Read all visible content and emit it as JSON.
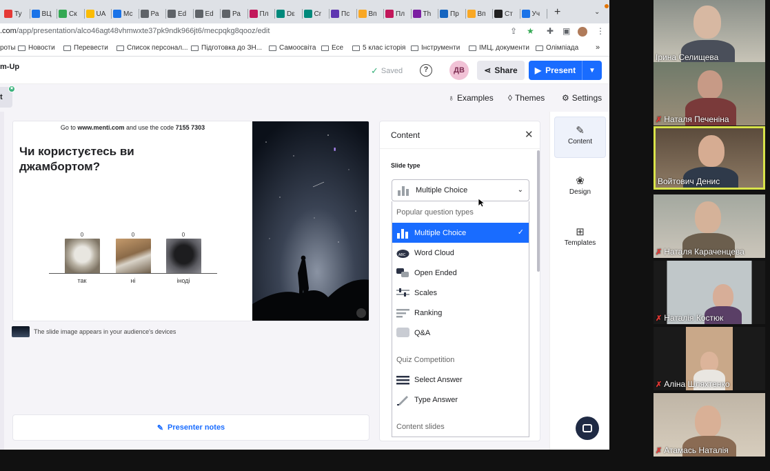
{
  "browser": {
    "tabs": [
      {
        "label": "Ty",
        "color": "#e53935"
      },
      {
        "label": "ВЦ",
        "color": "#1a73e8"
      },
      {
        "label": "Ск",
        "color": "#34a853"
      },
      {
        "label": "UA",
        "color": "#fbbc04"
      },
      {
        "label": "Мс",
        "color": "#1a73e8"
      },
      {
        "label": "Ра",
        "color": "#5f6368"
      },
      {
        "label": "Ed",
        "color": "#5f6368"
      },
      {
        "label": "Ed",
        "color": "#5f6368"
      },
      {
        "label": "Ра",
        "color": "#5f6368"
      },
      {
        "label": "Пл",
        "color": "#c2185b"
      },
      {
        "label": "Dε",
        "color": "#00897b"
      },
      {
        "label": "Cr",
        "color": "#00897b"
      },
      {
        "label": "Пс",
        "color": "#5e35b1"
      },
      {
        "label": "Вп",
        "color": "#f9a825"
      },
      {
        "label": "Пл",
        "color": "#c2185b"
      },
      {
        "label": "Th",
        "color": "#7b1fa2"
      },
      {
        "label": "Пр",
        "color": "#1565c0"
      },
      {
        "label": "Вп",
        "color": "#f9a825"
      },
      {
        "label": "Ст",
        "color": "#212121"
      },
      {
        "label": "Уч",
        "color": "#1a73e8"
      }
    ],
    "url_prefix": ".com",
    "url_path": "/app/presentation/alco46agt48vhmwxte37pk9ndk966jt6/mecpqkg8qooz/edit",
    "bookmarks": [
      "роты",
      "Новости",
      "Перевести",
      "Список персонал...",
      "Підготовка до ЗН...",
      "Самоосвіта",
      "Есе",
      "5 клас історія",
      "Інструменти",
      "ІМЦ, документи",
      "Олімпіада"
    ],
    "bookmarks_more": "»"
  },
  "app": {
    "title": "m-Up",
    "saved_label": "Saved",
    "help_icon": "?",
    "avatar_initials": "ДВ",
    "share_label": "Share",
    "present_label": "Present",
    "result_tab": "t",
    "examples_label": "Examples",
    "themes_label": "Themes",
    "settings_label": "Settings",
    "accent_color": "#196cff"
  },
  "slide": {
    "join_prefix": "Go to",
    "join_site": "www.menti.com",
    "join_mid": "and use the code",
    "join_code": "7155 7303",
    "question": "Чи користуєтесь ви джамбортом?",
    "options": [
      {
        "label": "так",
        "count": "0"
      },
      {
        "label": "ні",
        "count": "0"
      },
      {
        "label": "іноді",
        "count": "0"
      }
    ],
    "image_note": "The slide image appears in your audience's devices",
    "presenter_notes_label": "Presenter notes"
  },
  "panel": {
    "title": "Content",
    "slide_type_label": "Slide type",
    "selected_type": "Multiple Choice",
    "groups": [
      {
        "heading": "Popular question types",
        "items": [
          "Multiple Choice",
          "Word Cloud",
          "Open Ended",
          "Scales",
          "Ranking",
          "Q&A"
        ]
      },
      {
        "heading": "Quiz Competition",
        "items": [
          "Select Answer",
          "Type Answer"
        ]
      },
      {
        "heading": "Content slides",
        "items": []
      }
    ]
  },
  "rail": {
    "items": [
      {
        "label": "Content",
        "icon": "pencil-icon"
      },
      {
        "label": "Design",
        "icon": "palette-icon"
      },
      {
        "label": "Templates",
        "icon": "grid-icon"
      }
    ]
  },
  "participants": [
    {
      "name": "Ірина Селищева",
      "muted": false
    },
    {
      "name": "Наталя Печеніна",
      "muted": true
    },
    {
      "name": "Войтович Денис",
      "muted": false
    },
    {
      "name": "Наталя Караченцева",
      "muted": true
    },
    {
      "name": "Наталія Костюк",
      "muted": true
    },
    {
      "name": "Аліна Шляхтенко",
      "muted": true
    },
    {
      "name": "Атамась Наталія",
      "muted": true
    }
  ]
}
